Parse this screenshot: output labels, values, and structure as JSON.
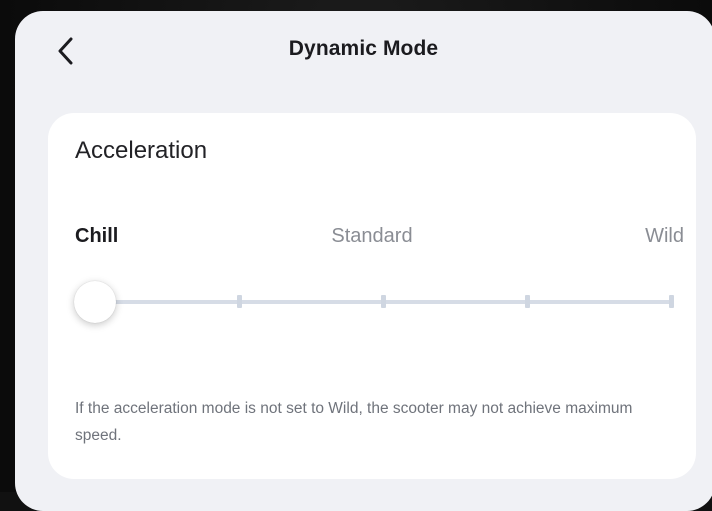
{
  "header": {
    "title": "Dynamic Mode",
    "back_icon": "chevron-left-icon"
  },
  "acceleration": {
    "title": "Acceleration",
    "levels": [
      "Chill",
      "Standard",
      "Wild"
    ],
    "selected_level": "Chill",
    "slider": {
      "steps": 5,
      "selected_step": 0
    },
    "note": "If the acceleration mode is not set to Wild, the scooter may not achieve maximum speed."
  },
  "colors": {
    "background": "#f0f1f5",
    "card": "#ffffff",
    "title_text": "#1b1b1f",
    "muted_text": "#8a8d94",
    "track": "#d6dce6"
  }
}
